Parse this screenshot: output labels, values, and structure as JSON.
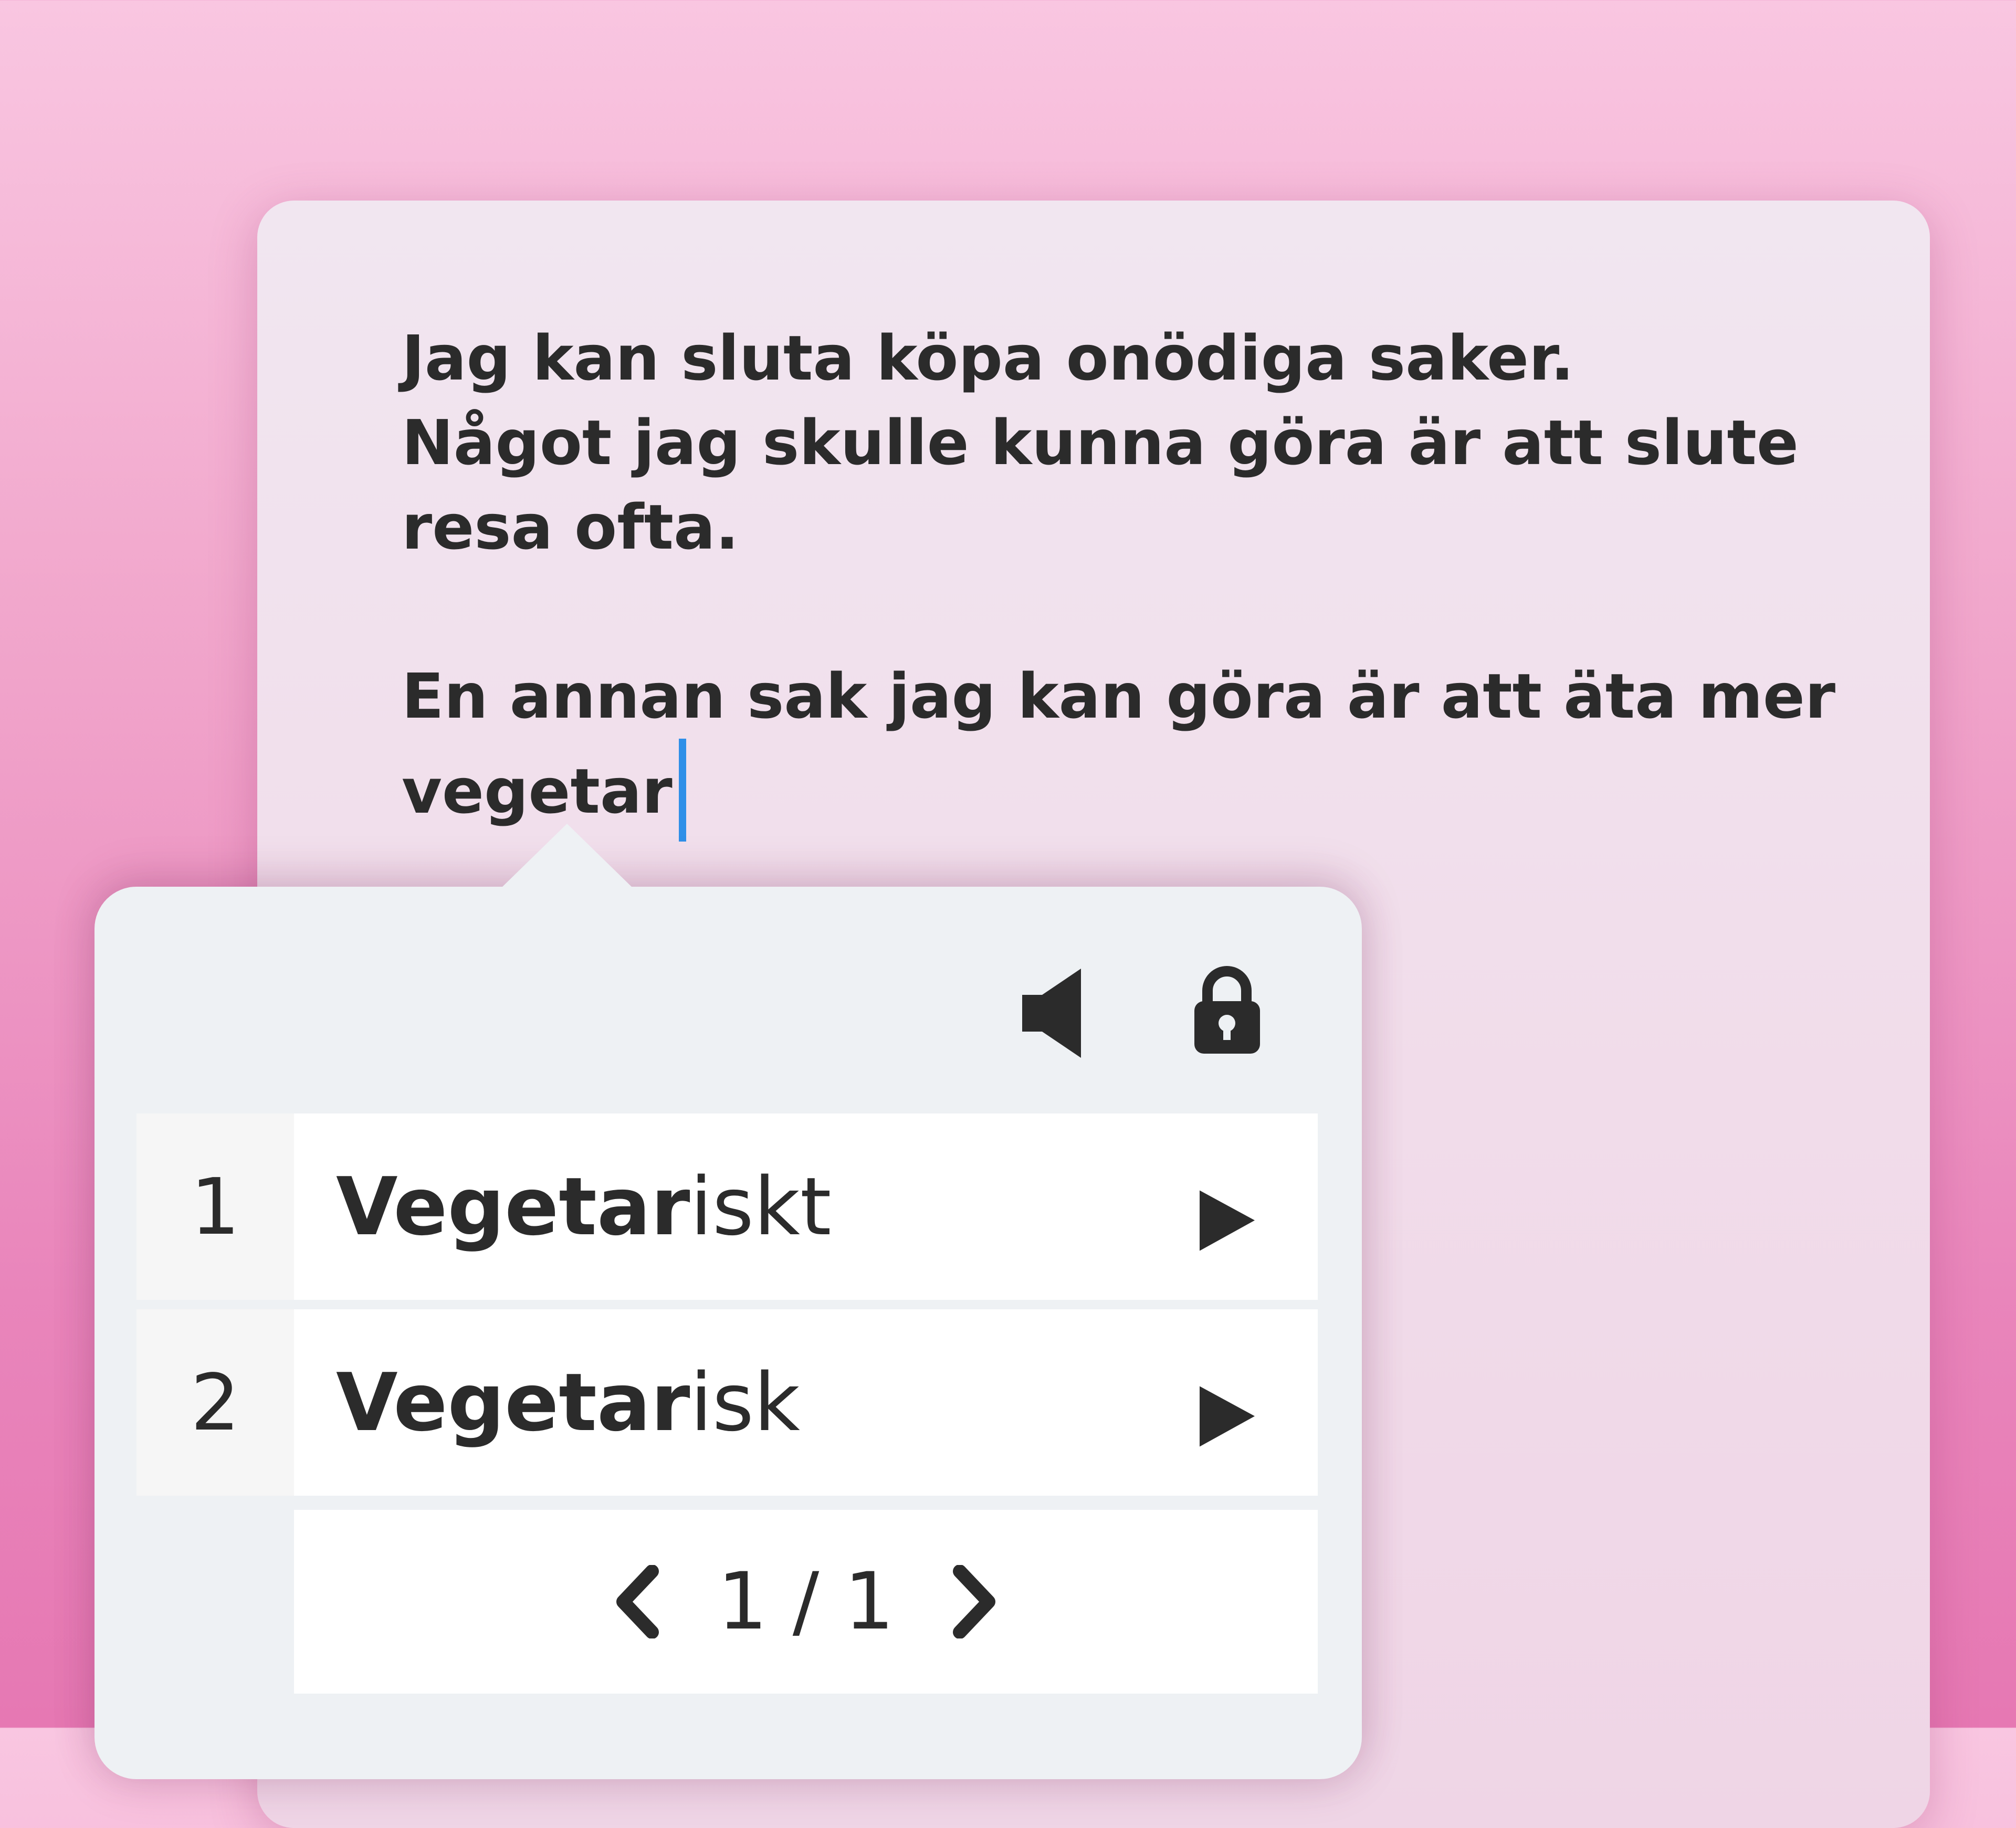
{
  "editor": {
    "lines": [
      "Jag kan sluta köpa onödiga saker.",
      "Något jag skulle kunna göra är att slute",
      "resa ofta."
    ],
    "paragraph2_line1": "En annan sak jag kan göra är att äta mer",
    "typing_word": "vegetar"
  },
  "popup": {
    "icons": {
      "speaker": "speaker-icon",
      "lock": "lock-icon",
      "play": "play-icon",
      "prev": "chevron-left-icon",
      "next": "chevron-right-icon"
    },
    "suggestions": [
      {
        "number": "1",
        "match": "Vegetar",
        "rest": "iskt"
      },
      {
        "number": "2",
        "match": "Vegetar",
        "rest": "isk"
      }
    ],
    "pager": {
      "text": "1 / 1"
    }
  },
  "colors": {
    "background_top": "#f9c6e1",
    "background_bottom": "#e678b3",
    "caret": "#2f8fe8",
    "text": "#2b2b2b",
    "popup_bg": "#eef1f4"
  }
}
